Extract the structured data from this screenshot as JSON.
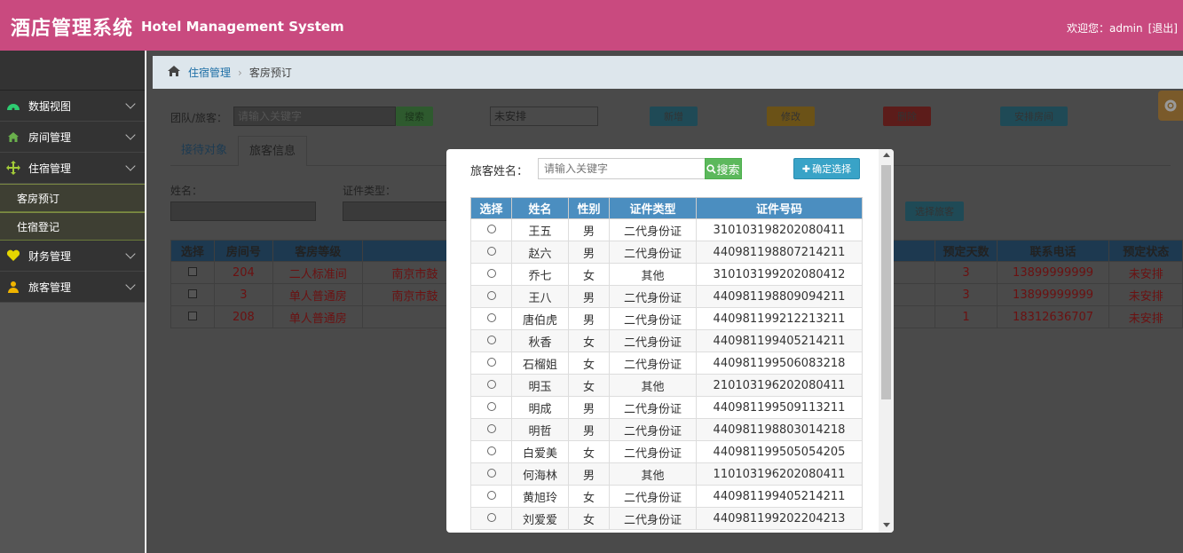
{
  "header": {
    "title_cn": "酒店管理系统",
    "title_en": "Hotel Management System",
    "welcome": "欢迎您：",
    "username": "admin",
    "logout": "[退出]"
  },
  "sidebar": {
    "items": [
      {
        "label": "数据视图",
        "icon": "dashboard-icon",
        "color": "#2ecc71"
      },
      {
        "label": "房间管理",
        "icon": "home-icon",
        "color": "#6ab04c"
      },
      {
        "label": "住宿管理",
        "icon": "move-icon",
        "color": "#a3cb38"
      },
      {
        "label": "财务管理",
        "icon": "heart-icon",
        "color": "#e6d600"
      },
      {
        "label": "旅客管理",
        "icon": "user-icon",
        "color": "#f0b400"
      }
    ],
    "sub_items": [
      "客房预订",
      "住宿登记"
    ]
  },
  "breadcrumb": {
    "parent": "住宿管理",
    "current": "客房预订"
  },
  "background": {
    "filter_label": "团队/旅客：",
    "filter_placeholder": "请输入关键字",
    "search_label": "搜索",
    "status_select": "未安排",
    "add_label": "新增",
    "edit_label": "修改",
    "delete_label": "删除",
    "arrange_label": "安排房间",
    "tabs": [
      "接待对象",
      "旅客信息"
    ],
    "name_label": "姓名：",
    "id_type_label": "证件类型：",
    "select_guest_label": "选择旅客",
    "table_headers": [
      "选择",
      "房间号",
      "客房等级",
      "预定天数",
      "联系电话",
      "预定状态"
    ],
    "rows": [
      {
        "room": "204",
        "level": "二人标准间",
        "place": "南京市鼓",
        "days": "3",
        "phone": "13899999999",
        "status": "未安排"
      },
      {
        "room": "3",
        "level": "单人普通房",
        "place": "南京市鼓",
        "days": "3",
        "phone": "13899999999",
        "status": "未安排"
      },
      {
        "room": "208",
        "level": "单人普通房",
        "place": "",
        "days": "1",
        "phone": "18312636707",
        "status": "未安排"
      }
    ]
  },
  "modal": {
    "search_label": "旅客姓名：",
    "search_placeholder": "请输入关键字",
    "search_button": "搜索",
    "confirm_button": "确定选择",
    "headers": [
      "选择",
      "姓名",
      "性别",
      "证件类型",
      "证件号码"
    ],
    "rows": [
      {
        "name": "王五",
        "gender": "男",
        "id_type": "二代身份证",
        "id_no": "310103198202080411"
      },
      {
        "name": "赵六",
        "gender": "男",
        "id_type": "二代身份证",
        "id_no": "440981198807214211"
      },
      {
        "name": "乔七",
        "gender": "女",
        "id_type": "其他",
        "id_no": "310103199202080412"
      },
      {
        "name": "王八",
        "gender": "男",
        "id_type": "二代身份证",
        "id_no": "440981198809094211"
      },
      {
        "name": "唐伯虎",
        "gender": "男",
        "id_type": "二代身份证",
        "id_no": "440981199212213211"
      },
      {
        "name": "秋香",
        "gender": "女",
        "id_type": "二代身份证",
        "id_no": "440981199405214211"
      },
      {
        "name": "石榴姐",
        "gender": "女",
        "id_type": "二代身份证",
        "id_no": "440981199506083218"
      },
      {
        "name": "明玉",
        "gender": "女",
        "id_type": "其他",
        "id_no": "210103196202080411"
      },
      {
        "name": "明成",
        "gender": "男",
        "id_type": "二代身份证",
        "id_no": "440981199509113211"
      },
      {
        "name": "明哲",
        "gender": "男",
        "id_type": "二代身份证",
        "id_no": "440981198803014218"
      },
      {
        "name": "白爱美",
        "gender": "女",
        "id_type": "二代身份证",
        "id_no": "440981199505054205"
      },
      {
        "name": "何海林",
        "gender": "男",
        "id_type": "其他",
        "id_no": "110103196202080411"
      },
      {
        "name": "黄旭玲",
        "gender": "女",
        "id_type": "二代身份证",
        "id_no": "440981199405214211"
      },
      {
        "name": "刘爱爱",
        "gender": "女",
        "id_type": "二代身份证",
        "id_no": "440981199202204213"
      }
    ]
  }
}
